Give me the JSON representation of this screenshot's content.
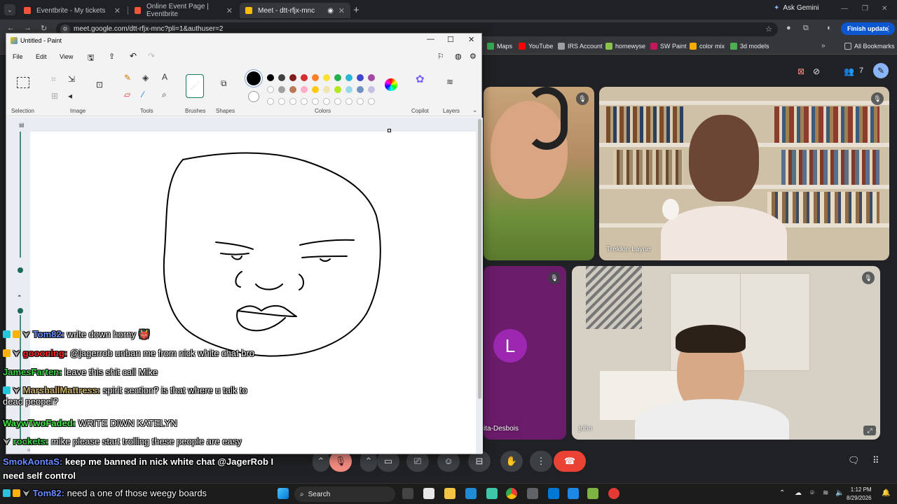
{
  "browser": {
    "tabs": [
      {
        "label": "Eventbrite - My tickets",
        "color": "#f05537"
      },
      {
        "label": "Online Event Page | Eventbrite",
        "color": "#f05537"
      },
      {
        "label": "Meet - dtt-rfjx-mnc",
        "color": "#fbbc04"
      }
    ],
    "ask_gemini": "Ask Gemini",
    "url": "meet.google.com/dtt-rfjx-mnc?pli=1&authuser=2",
    "finish_update": "Finish update",
    "bookmarks": [
      {
        "label": "Maps",
        "color": "#34a853"
      },
      {
        "label": "YouTube",
        "color": "#ff0000"
      },
      {
        "label": "IRS Account",
        "color": "#9aa0a6"
      },
      {
        "label": "homewyse",
        "color": "#8bc34a"
      },
      {
        "label": "SW Paint",
        "color": "#c2185b"
      },
      {
        "label": "color mix",
        "color": "#f9ab00"
      },
      {
        "label": "3d models",
        "color": "#4caf50"
      }
    ],
    "all_bookmarks": "All Bookmarks"
  },
  "meet": {
    "participant_count": "7",
    "tiles": [
      {
        "name": "",
        "color": "#8d7a5a"
      },
      {
        "name": "Treldon Layne",
        "color": "#b59a78"
      },
      {
        "name": "ita-Desbois",
        "initial": "L",
        "color": "#6a1b6a"
      },
      {
        "name": "john",
        "color": "#cfc8bd"
      }
    ]
  },
  "paint": {
    "title": "Untitled - Paint",
    "menu": [
      "File",
      "Edit",
      "View"
    ],
    "groups": [
      "Selection",
      "Image",
      "Tools",
      "Brushes",
      "Shapes",
      "Colors",
      "Copilot",
      "Layers"
    ],
    "palette": [
      "#000000",
      "#404040",
      "#7f1d1d",
      "#d32f2f",
      "#ff7f27",
      "#fbe035",
      "#22b14c",
      "#29b6d6",
      "#3f48cc",
      "#a349a4",
      "#ffffff",
      "#a0a0a0",
      "#b97a57",
      "#ffaec9",
      "#ffc90e",
      "#efe4b0",
      "#b5e61d",
      "#99d9ea",
      "#7092be",
      "#c8bfe7"
    ]
  },
  "chat": [
    {
      "user": "Tom82:",
      "user_color": "#6b8cff",
      "msg": "write down horny 👹"
    },
    {
      "user": "goooning:",
      "user_color": "#ff2a2a",
      "msg": "@jagerrob unban me from nick white chat bro"
    },
    {
      "user": "JamesFarten:",
      "user_color": "#3cd14a",
      "msg": "leave this shit call Mike"
    },
    {
      "user": "MarshallMattress:",
      "user_color": "#c9b26b",
      "msg": "spirit section? is that where u talk to",
      "msg2": "dead peopel?"
    },
    {
      "user": "WaywTwoFaded:",
      "user_color": "#46e64a",
      "msg": "WRITE DIWN KATELYN"
    },
    {
      "user": "rockets:",
      "user_color": "#3cd14a",
      "msg": "mike please start trolling these people are easy"
    },
    {
      "user": "SmokAontaS:",
      "user_color": "#6b8cff",
      "msg": "keep me banned in nick white chat @JagerRob I",
      "msg2": "need self control"
    },
    {
      "user": "Tom82:",
      "user_color": "#6b8cff",
      "msg": "need a one of those weegy boards"
    }
  ],
  "taskbar": {
    "search": "Search",
    "time": "1:12 PM",
    "date": "8/29/2026"
  }
}
